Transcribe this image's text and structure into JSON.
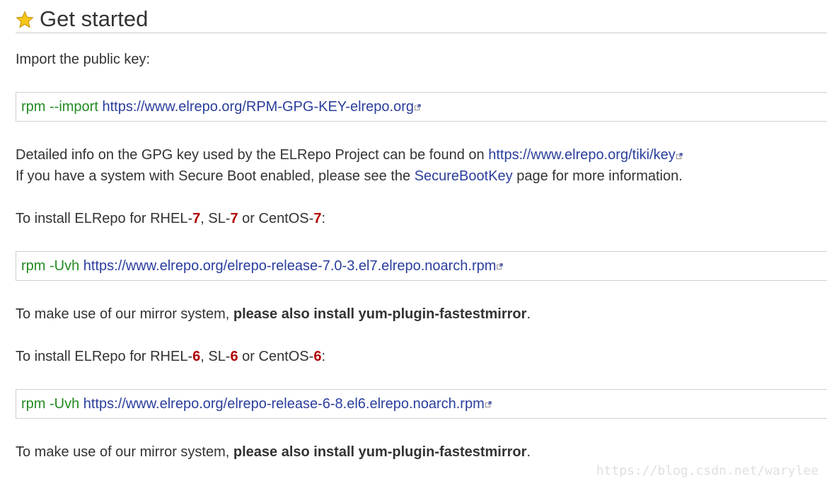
{
  "heading": {
    "icon": "star-icon",
    "title": "Get started"
  },
  "import_key": {
    "intro": "Import the public key:",
    "command": "rpm --import",
    "url": "https://www.elrepo.org/RPM-GPG-KEY-elrepo.org"
  },
  "gpg_info": {
    "text": "Detailed info on the GPG key used by the ELRepo Project can be found on",
    "url": "https://www.elrepo.org/tiki/key"
  },
  "secure_boot": {
    "prefix": "If you have a system with Secure Boot enabled, please see the",
    "link": "SecureBootKey",
    "suffix": "page for more information."
  },
  "el7": {
    "intro_a": "To install ELRepo for RHEL-",
    "intro_b": ", SL-",
    "intro_c": " or CentOS-",
    "intro_d": ":",
    "version": "7",
    "command": "rpm -Uvh",
    "url": "https://www.elrepo.org/elrepo-release-7.0-3.el7.elrepo.noarch.rpm"
  },
  "mirror_note_1": {
    "prefix": "To make use of our mirror system,",
    "bold": "please also install yum-plugin-fastestmirror",
    "suffix": "."
  },
  "el6": {
    "intro_a": "To install ELRepo for RHEL-",
    "intro_b": ", SL-",
    "intro_c": " or CentOS-",
    "intro_d": ":",
    "version": "6",
    "command": "rpm -Uvh",
    "url": "https://www.elrepo.org/elrepo-release-6-8.el6.elrepo.noarch.rpm"
  },
  "mirror_note_2": {
    "prefix": "To make use of our mirror system,",
    "bold": "please also install yum-plugin-fastestmirror",
    "suffix": "."
  },
  "watermark": "https://blog.csdn.net/warylee",
  "colors": {
    "link": "#2a3e9c",
    "command": "#228b22",
    "version": "#b00000",
    "text": "#333333"
  }
}
